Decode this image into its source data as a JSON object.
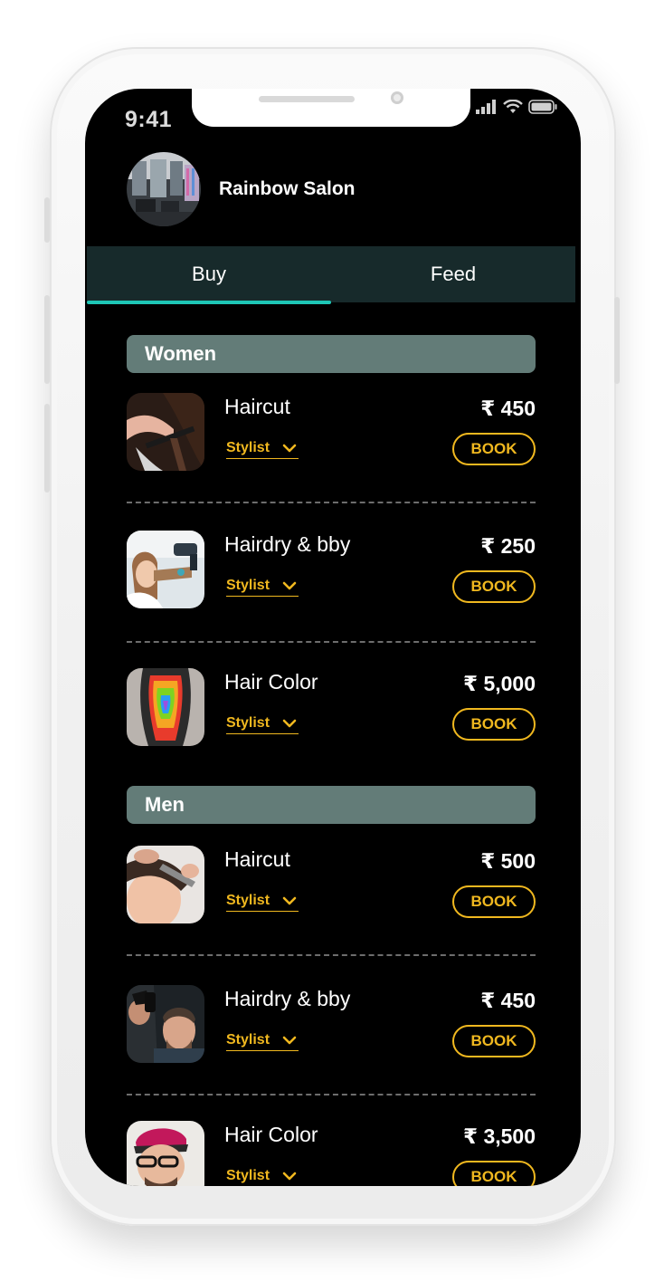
{
  "status_bar": {
    "time": "9:41"
  },
  "salon": {
    "name": "Rainbow Salon"
  },
  "tabs": [
    {
      "label": "Buy",
      "active": true
    },
    {
      "label": "Feed",
      "active": false
    }
  ],
  "sections": [
    {
      "title": "Women",
      "items": [
        {
          "name": "Haircut",
          "stylist_label": "Stylist",
          "price": "₹ 450",
          "book_label": "BOOK"
        },
        {
          "name": "Hairdry & bby",
          "stylist_label": "Stylist",
          "price": "₹ 250",
          "book_label": "BOOK"
        },
        {
          "name": "Hair Color",
          "stylist_label": "Stylist",
          "price": "₹ 5,000",
          "book_label": "BOOK"
        }
      ]
    },
    {
      "title": "Men",
      "items": [
        {
          "name": "Haircut",
          "stylist_label": "Stylist",
          "price": "₹ 500",
          "book_label": "BOOK"
        },
        {
          "name": "Hairdry & bby",
          "stylist_label": "Stylist",
          "price": "₹ 450",
          "book_label": "BOOK"
        },
        {
          "name": "Hair Color",
          "stylist_label": "Stylist",
          "price": "₹ 3,500",
          "book_label": "BOOK"
        }
      ]
    }
  ],
  "colors": {
    "accent": "#f0b81f",
    "tab_indicator": "#1ec7b6",
    "tab_bar": "#172a2b",
    "section_header": "#637c78",
    "background": "#000000"
  },
  "icons": [
    "signal-icon",
    "wifi-icon",
    "battery-icon",
    "chevron-down-icon"
  ]
}
